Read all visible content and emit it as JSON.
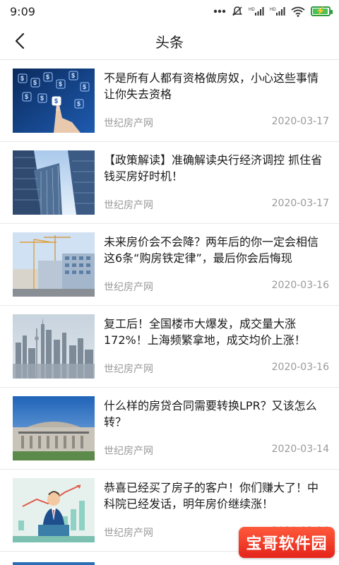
{
  "status_bar": {
    "time": "9:09",
    "icons": [
      "dots-icon",
      "mute-icon",
      "hd-signal-icon",
      "hd-signal-icon",
      "wifi-icon",
      "battery-charging-icon"
    ],
    "battery_color": "#4cc15a"
  },
  "header": {
    "title": "头条",
    "back_icon": "chevron-left-icon"
  },
  "news": [
    {
      "title": "不是所有人都有资格做房奴，小心这些事情让你失去资格",
      "source": "世纪房产网",
      "date": "2020-03-17",
      "thumb": "finance-dollar-hand"
    },
    {
      "title": "【政策解读】准确解读央行经济调控 抓住省钱买房好时机！",
      "source": "世纪房产网",
      "date": "2020-03-17",
      "thumb": "skyscrapers"
    },
    {
      "title": "未来房价会不会降？两年后的你一定会相信这6条“购房铁定律”，最后你会后悔现",
      "source": "世纪房产网",
      "date": "2020-03-16",
      "thumb": "construction-site"
    },
    {
      "title": "复工后！全国楼市大爆发，成交量大涨172%！上海频繁拿地，成交均价上涨！",
      "source": "世纪房产网",
      "date": "2020-03-16",
      "thumb": "city-skyline"
    },
    {
      "title": "什么样的房贷合同需要转换LPR？又该怎么转？",
      "source": "世纪房产网",
      "date": "2020-03-14",
      "thumb": "bank-building"
    },
    {
      "title": "恭喜已经买了房子的客户！你们赚大了！中科院已经发话，明年房价继续涨！",
      "source": "世纪房产网",
      "date": "2020-03-14",
      "thumb": "speaker-chart"
    }
  ],
  "watermark": {
    "text": "宝哥软件园"
  }
}
